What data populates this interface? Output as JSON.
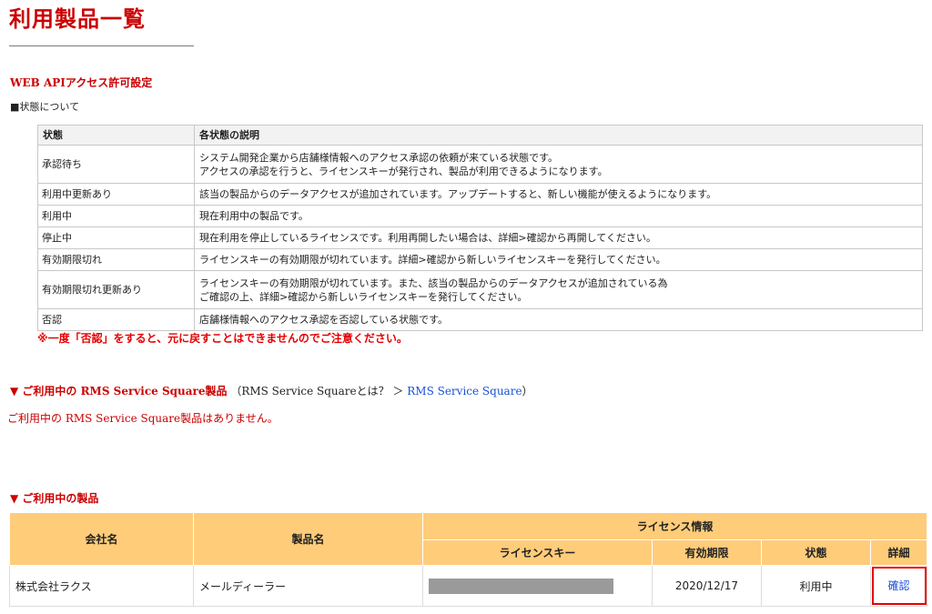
{
  "page": {
    "title": "利用製品一覧"
  },
  "api_section": {
    "heading": "WEB APIアクセス許可設定",
    "state_label": "■状態について",
    "table": {
      "headers": [
        "状態",
        "各状態の説明"
      ],
      "rows": [
        {
          "state": "承認待ち",
          "desc1": "システム開発企業から店舗様情報へのアクセス承認の依頼が来ている状態です。",
          "desc2": "アクセスの承認を行うと、ライセンスキーが発行され、製品が利用できるようになります。"
        },
        {
          "state": "利用中更新あり",
          "desc1": "該当の製品からのデータアクセスが追加されています。アップデートすると、新しい機能が使えるようになります。",
          "desc2": ""
        },
        {
          "state": "利用中",
          "desc1": "現在利用中の製品です。",
          "desc2": ""
        },
        {
          "state": "停止中",
          "desc1": "現在利用を停止しているライセンスです。利用再開したい場合は、詳細>確認から再開してください。",
          "desc2": ""
        },
        {
          "state": "有効期限切れ",
          "desc1": "ライセンスキーの有効期限が切れています。詳細>確認から新しいライセンスキーを発行してください。",
          "desc2": ""
        },
        {
          "state": "有効期限切れ更新あり",
          "desc1": "ライセンスキーの有効期限が切れています。また、該当の製品からのデータアクセスが追加されている為",
          "desc2": "ご確認の上、詳細>確認から新しいライセンスキーを発行してください。"
        },
        {
          "state": "否認",
          "desc1": "店舗様情報へのアクセス承認を否認している状態です。",
          "desc2": ""
        }
      ]
    },
    "note": "※一度「否認」をすると、元に戻すことはできませんのでご注意ください。"
  },
  "rms_section": {
    "heading": "▼ ご利用中の RMS Service Square製品",
    "sub_prefix": "（RMS Service Squareとは？ ＞ ",
    "link": "RMS Service Square",
    "sub_suffix": "）",
    "empty_message": "ご利用中の RMS Service Square製品はありません。"
  },
  "products_section": {
    "heading": "▼ ご利用中の製品",
    "headers": {
      "company": "会社名",
      "product": "製品名",
      "license_group": "ライセンス情報",
      "license_key": "ライセンスキー",
      "expiry": "有効期限",
      "status": "状態",
      "detail": "詳細"
    },
    "rows": [
      {
        "company": "株式会社ラクス",
        "product": "メールディーラー",
        "license_key_masked": true,
        "expiry": "2020/12/17",
        "status": "利用中",
        "detail": "確認"
      }
    ]
  },
  "colors": {
    "title_red": "#cc0000",
    "note_red": "#e60000",
    "table_header_orange": "#ffcc7a",
    "link_blue": "#1a4fd6",
    "status_green": "#2a8a2a"
  }
}
